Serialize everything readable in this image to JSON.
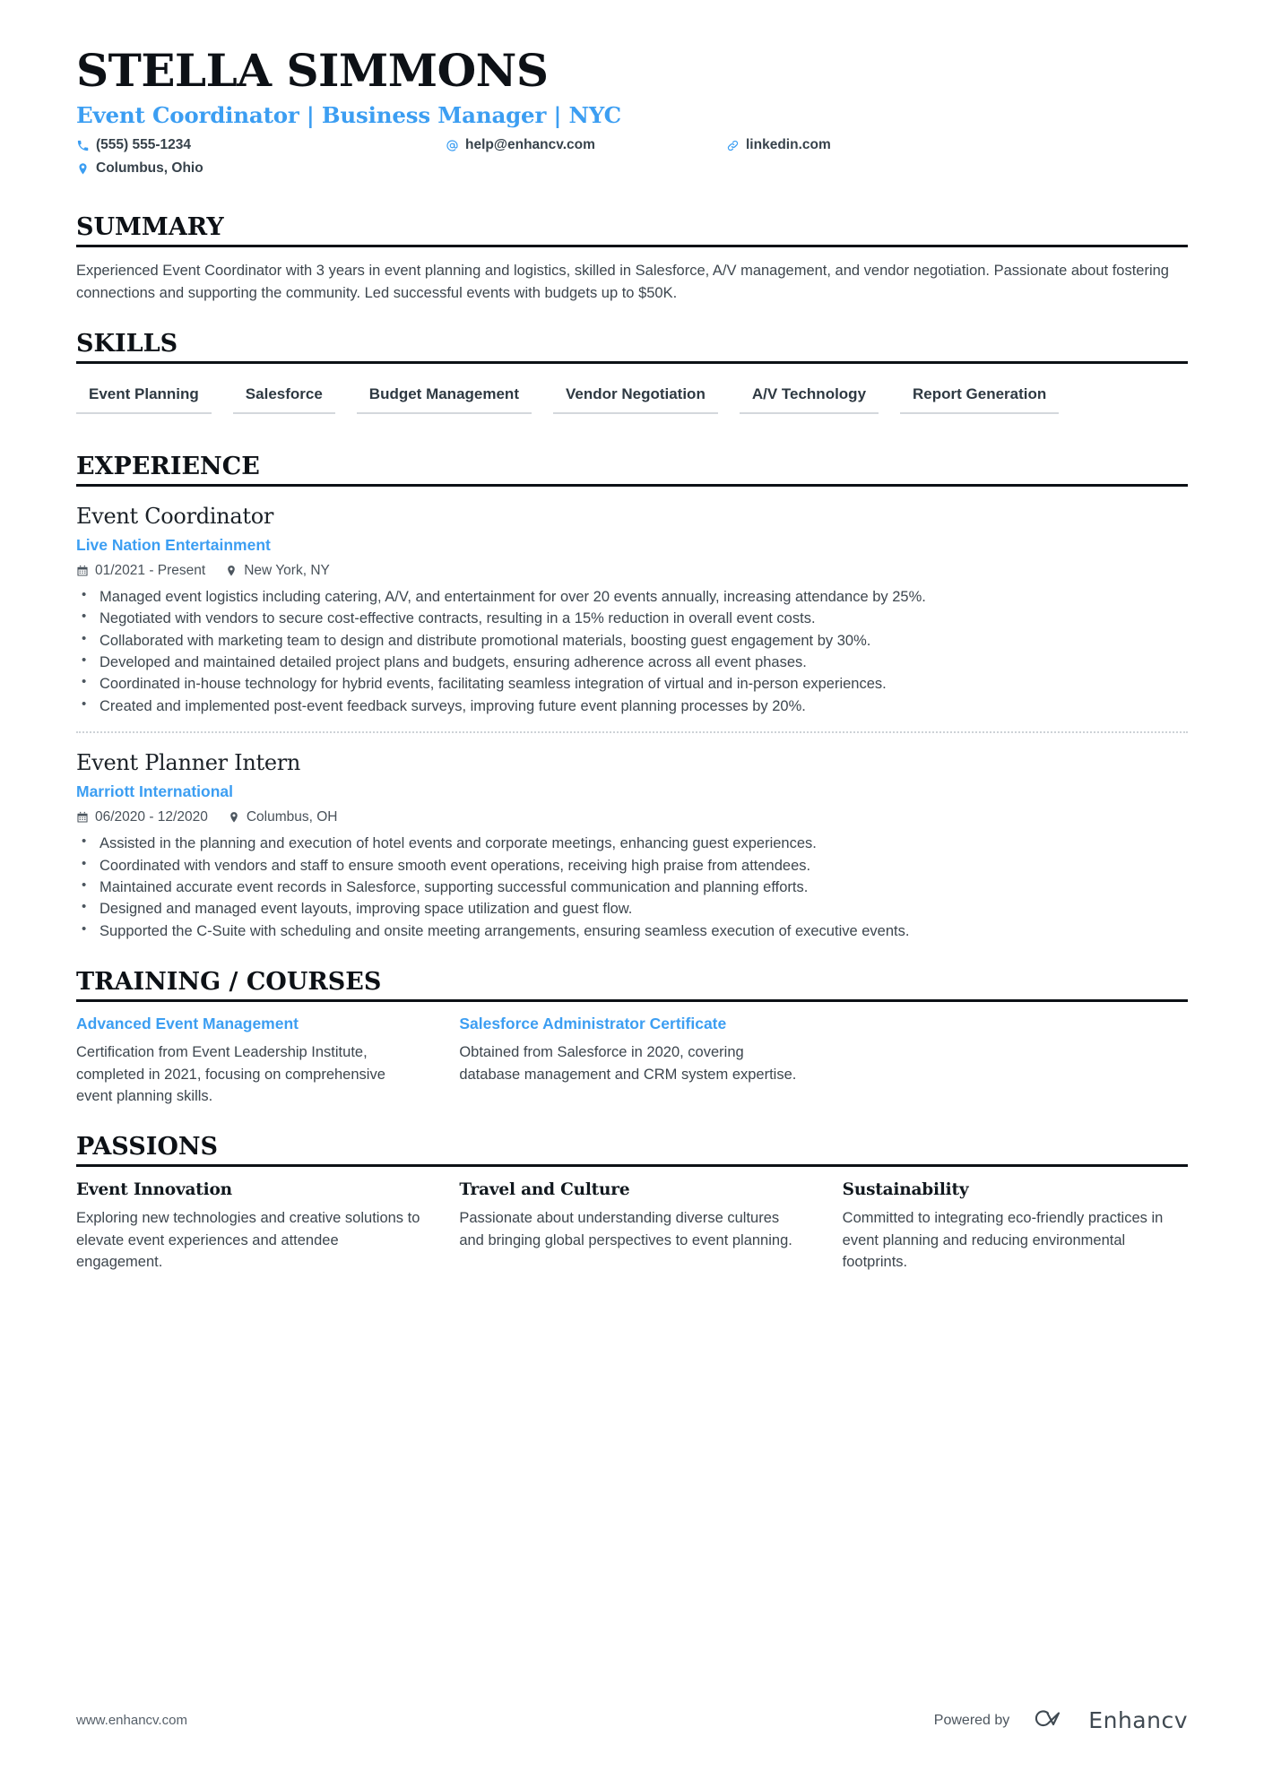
{
  "header": {
    "name": "STELLA SIMMONS",
    "headline": "Event Coordinator | Business Manager | NYC",
    "contacts": {
      "phone": "(555) 555-1234",
      "email": "help@enhancv.com",
      "link": "linkedin.com",
      "location": "Columbus, Ohio"
    }
  },
  "sections": {
    "summary": {
      "title": "SUMMARY",
      "text": "Experienced Event Coordinator with 3 years in event planning and logistics, skilled in Salesforce, A/V management, and vendor negotiation. Passionate about fostering connections and supporting the community. Led successful events with budgets up to $50K."
    },
    "skills": {
      "title": "SKILLS",
      "items": [
        "Event Planning",
        "Salesforce",
        "Budget Management",
        "Vendor Negotiation",
        "A/V Technology",
        "Report Generation"
      ]
    },
    "experience": {
      "title": "EXPERIENCE",
      "jobs": [
        {
          "title": "Event Coordinator",
          "company": "Live Nation Entertainment",
          "dates": "01/2021 - Present",
          "location": "New York, NY",
          "bullets": [
            "Managed event logistics including catering, A/V, and entertainment for over 20 events annually, increasing attendance by 25%.",
            "Negotiated with vendors to secure cost-effective contracts, resulting in a 15% reduction in overall event costs.",
            "Collaborated with marketing team to design and distribute promotional materials, boosting guest engagement by 30%.",
            "Developed and maintained detailed project plans and budgets, ensuring adherence across all event phases.",
            "Coordinated in-house technology for hybrid events, facilitating seamless integration of virtual and in-person experiences.",
            "Created and implemented post-event feedback surveys, improving future event planning processes by 20%."
          ]
        },
        {
          "title": "Event Planner Intern",
          "company": "Marriott International",
          "dates": "06/2020 - 12/2020",
          "location": "Columbus, OH",
          "bullets": [
            "Assisted in the planning and execution of hotel events and corporate meetings, enhancing guest experiences.",
            "Coordinated with vendors and staff to ensure smooth event operations, receiving high praise from attendees.",
            "Maintained accurate event records in Salesforce, supporting successful communication and planning efforts.",
            "Designed and managed event layouts, improving space utilization and guest flow.",
            "Supported the C-Suite with scheduling and onsite meeting arrangements, ensuring seamless execution of executive events."
          ]
        }
      ]
    },
    "training": {
      "title": "TRAINING / COURSES",
      "items": [
        {
          "title": "Advanced Event Management",
          "description": "Certification from Event Leadership Institute, completed in 2021, focusing on comprehensive event planning skills."
        },
        {
          "title": "Salesforce Administrator Certificate",
          "description": "Obtained from Salesforce in 2020, covering database management and CRM system expertise."
        }
      ]
    },
    "passions": {
      "title": "PASSIONS",
      "items": [
        {
          "title": "Event Innovation",
          "description": "Exploring new technologies and creative solutions to elevate event experiences and attendee engagement."
        },
        {
          "title": "Travel and Culture",
          "description": "Passionate about understanding diverse cultures and bringing global perspectives to event planning."
        },
        {
          "title": "Sustainability",
          "description": "Committed to integrating eco-friendly practices in event planning and reducing environmental footprints."
        }
      ]
    }
  },
  "footer": {
    "url": "www.enhancv.com",
    "powered_by": "Powered by",
    "brand": "Enhancv"
  },
  "colors": {
    "accent": "#3c9ef2",
    "ink": "#0d1116",
    "body": "#3d464e"
  },
  "icons": {
    "phone": "phone-icon",
    "email": "at-sign-icon",
    "link": "link-icon",
    "location": "map-pin-icon",
    "calendar": "calendar-icon"
  }
}
